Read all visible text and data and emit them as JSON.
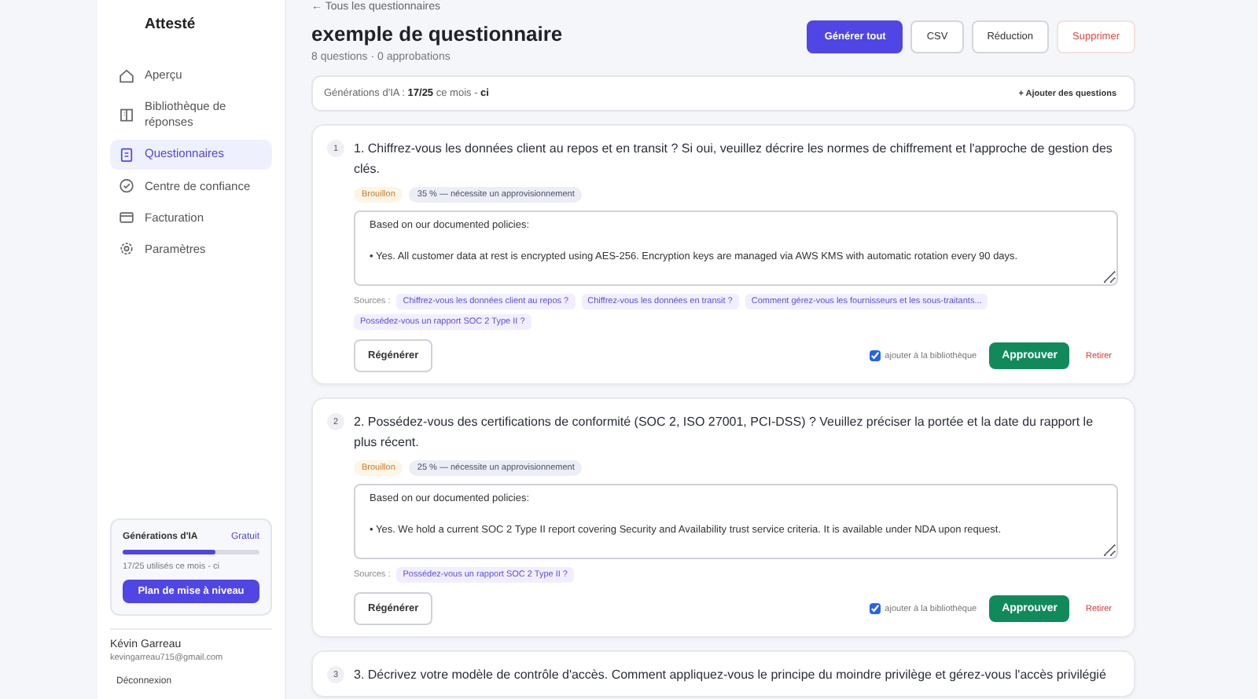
{
  "app": {
    "name": "Attesté"
  },
  "sidebar": {
    "items": [
      {
        "label": "Aperçu",
        "selected": false
      },
      {
        "label": "Bibliothèque de réponses",
        "selected": false
      },
      {
        "label": "Questionnaires",
        "selected": true
      },
      {
        "label": "Centre de confiance",
        "selected": false
      },
      {
        "label": "Facturation",
        "selected": false
      },
      {
        "label": "Paramètres",
        "selected": false
      }
    ]
  },
  "usage_card": {
    "title": "Générations d'IA",
    "plan": "Gratuit",
    "level": 0.68,
    "caption": "17/25 utilisés ce mois - ci",
    "button": "Plan de mise à niveau"
  },
  "user": {
    "name": "Kévin Garreau",
    "email": "kevingarreau715@gmail.com",
    "logout": "Déconnexion"
  },
  "header": {
    "back_link": "← Tous les questionnaires",
    "title": "exemple de questionnaire",
    "subtitle": "8 questions · 0 approbations",
    "buttons": [
      {
        "label": "Générer tout",
        "kind": "primary"
      },
      {
        "label": "CSV",
        "kind": "outline"
      },
      {
        "label": "Réduction",
        "kind": "outline"
      },
      {
        "label": "Supprimer",
        "kind": "danger"
      }
    ]
  },
  "ai_bar": {
    "text": "Générations d'IA : **17/25** ce mois - **ci**",
    "action": "+ Ajouter des questions"
  },
  "questions": [
    {
      "number": "1",
      "text": "1. Chiffrez-vous les données client au repos et en transit ? Si oui, veuillez décrire les normes de chiffrement et l'approche de gestion des clés.",
      "status": "Brouillon",
      "confidence": "35 % — nécessite un approvisionnement",
      "answer": "Based on our documented policies:\n\n• Yes. All customer data at rest is encrypted using AES-256. Encryption keys are managed via AWS KMS with automatic rotation every 90 days.",
      "sources_label": "Sources :",
      "sources": [
        "Chiffrez-vous les données client au repos ?",
        "Chiffrez-vous les données en transit ?",
        "Comment gérez-vous les fournisseurs et les sous-traitants...",
        "Possédez-vous un rapport SOC 2 Type II ?"
      ],
      "regenerate": "Régénérer",
      "add_to_library": {
        "label": "ajouter à la bibliothèque",
        "checked": true
      },
      "approve": "Approuver",
      "remove": "Retirer"
    },
    {
      "number": "2",
      "text": "2. Possédez-vous des certifications de conformité (SOC 2, ISO 27001, PCI-DSS) ? Veuillez préciser la portée et la date du rapport le plus récent.",
      "status": "Brouillon",
      "confidence": "25 % — nécessite un approvisionnement",
      "answer": "Based on our documented policies:\n\n• Yes. We hold a current SOC 2 Type II report covering Security and Availability trust service criteria. It is available under NDA upon request.",
      "sources_label": "Sources :",
      "sources": [
        "Possédez-vous un rapport SOC 2 Type II ?"
      ],
      "regenerate": "Régénérer",
      "add_to_library": {
        "label": "ajouter à la bibliothèque",
        "checked": true
      },
      "approve": "Approuver",
      "remove": "Retirer"
    },
    {
      "number": "3",
      "text": "3. Décrivez votre modèle de contrôle d'accès. Comment appliquez-vous le principe du moindre privilège et gérez-vous l'accès privilégié"
    }
  ]
}
